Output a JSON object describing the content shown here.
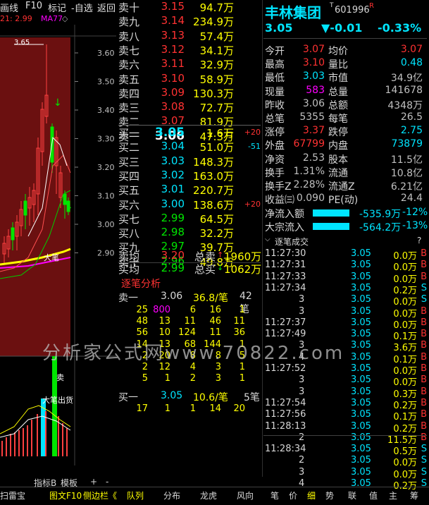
{
  "toolbar": {
    "items": [
      "画线",
      "F10",
      "标记",
      "-自选",
      "返回"
    ]
  },
  "indicator_line": {
    "prefix": "21: 2.99",
    "ma_label": "MA77"
  },
  "chart": {
    "y_ticks": [
      "3.60",
      "3.50",
      "3.40",
      "3.30",
      "3.20",
      "3.10",
      "3.00",
      "2.90"
    ],
    "high_label": "3.65",
    "big_pen_label": "大笔",
    "sub_labels": [
      "大笔出货"
    ],
    "x_ticks": [
      "2",
      "3"
    ],
    "period_label": "日线"
  },
  "stock": {
    "name": "丰林集团",
    "superscript": "T",
    "code": "601996",
    "r_mark": "R",
    "price": "3.05",
    "change": "▼-0.01",
    "change_pct": "-0.33%"
  },
  "order_book": {
    "asks": [
      {
        "label": "卖十",
        "price": "3.15",
        "vol": "94.7万"
      },
      {
        "label": "卖九",
        "price": "3.14",
        "vol": "234.9万"
      },
      {
        "label": "卖八",
        "price": "3.13",
        "vol": "57.4万"
      },
      {
        "label": "卖七",
        "price": "3.12",
        "vol": "34.1万"
      },
      {
        "label": "卖六",
        "price": "3.11",
        "vol": "32.9万"
      },
      {
        "label": "卖五",
        "price": "3.10",
        "vol": "58.9万"
      },
      {
        "label": "卖四",
        "price": "3.09",
        "vol": "130.3万"
      },
      {
        "label": "卖三",
        "price": "3.08",
        "vol": "72.7万"
      },
      {
        "label": "卖二",
        "price": "3.07",
        "vol": "81.9万"
      },
      {
        "label": "卖一",
        "price": "3.06",
        "vol": "47.3万"
      }
    ],
    "bids": [
      {
        "label": "买一",
        "price": "3.05",
        "vol": "1.6万",
        "chg": "+20"
      },
      {
        "label": "买二",
        "price": "3.04",
        "vol": "51.0万",
        "chg": "-51"
      },
      {
        "label": "买三",
        "price": "3.03",
        "vol": "148.3万",
        "chg": ""
      },
      {
        "label": "买四",
        "price": "3.02",
        "vol": "163.0万",
        "chg": ""
      },
      {
        "label": "买五",
        "price": "3.01",
        "vol": "220.7万",
        "chg": ""
      },
      {
        "label": "买六",
        "price": "3.00",
        "vol": "138.6万",
        "chg": "+20"
      },
      {
        "label": "买七",
        "price": "2.99",
        "vol": "64.5万",
        "chg": ""
      },
      {
        "label": "买八",
        "price": "2.98",
        "vol": "32.2万",
        "chg": ""
      },
      {
        "label": "买九",
        "price": "2.97",
        "vol": "39.7万",
        "chg": ""
      },
      {
        "label": "买十",
        "price": "2.96",
        "vol": "49.8万",
        "chg": ""
      }
    ],
    "ask_avg": {
      "label": "卖均",
      "price": "3.20",
      "total_label": "总卖",
      "total": "1960万"
    },
    "bid_avg": {
      "label": "买均",
      "price": "2.99",
      "total_label": "总买",
      "total": "1062万"
    }
  },
  "tick_analysis": {
    "title": "逐笔分析",
    "sell_header": {
      "label": "卖一",
      "price": "3.06",
      "vol": "36.8/笔",
      "count": "42笔"
    },
    "sell_grid": [
      [
        "25",
        "800",
        "6",
        "16",
        "1"
      ],
      [
        "48",
        "13",
        "11",
        "46",
        "11"
      ],
      [
        "56",
        "10",
        "124",
        "11",
        "36"
      ],
      [
        "14",
        "13",
        "68",
        "144",
        "1"
      ],
      [
        "2",
        "20",
        "8",
        "8",
        "5"
      ],
      [
        "2",
        "12",
        "4",
        "3",
        "1"
      ],
      [
        "5",
        "1",
        "2",
        "3",
        "1"
      ]
    ],
    "buy_header": {
      "label": "买一",
      "price": "3.05",
      "vol": "10.6/笔",
      "count": "5笔"
    },
    "buy_grid": [
      [
        "17",
        "1",
        "1",
        "14",
        "20"
      ]
    ]
  },
  "quote": {
    "rows": [
      {
        "l1": "今开",
        "v1": "3.07",
        "l2": "均价",
        "v2": "3.07"
      },
      {
        "l1": "最高",
        "v1": "3.10",
        "l2": "量比",
        "v2": "0.48"
      },
      {
        "l1": "最低",
        "v1": "3.03",
        "l2": "市值",
        "v2": "34.9亿"
      },
      {
        "l1": "现量",
        "v1": "583",
        "l2": "总量",
        "v2": "141678"
      },
      {
        "l1": "昨收",
        "v1": "3.06",
        "l2": "总额",
        "v2": "4348万"
      },
      {
        "l1": "总笔",
        "v1": "5355",
        "l2": "每笔",
        "v2": "26.5"
      },
      {
        "l1": "涨停",
        "v1": "3.37",
        "l2": "跌停",
        "v2": "2.75"
      },
      {
        "l1": "外盘",
        "v1": "67799",
        "l2": "内盘",
        "v2": "73879"
      },
      {
        "l1": "净资",
        "v1": "2.53",
        "l2": "股本",
        "v2": "11.5亿"
      },
      {
        "l1": "换手",
        "v1": "1.31%",
        "l2": "流通",
        "v2": "10.8亿"
      },
      {
        "l1": "换手Z",
        "v1": "2.28%",
        "l2": "流通Z",
        "v2": "6.21亿"
      },
      {
        "l1": "收益㈢",
        "v1": "0.090",
        "l2": "PE(动)",
        "v2": "24.4"
      }
    ],
    "net_inflow": {
      "label": "净流入额",
      "value": "-535.9万",
      "pct": "-12%"
    },
    "block_inflow": {
      "label": "大宗流入",
      "value": "-564.2万",
      "pct": "-13%"
    }
  },
  "trades": {
    "title": "逐笔成交",
    "rows": [
      {
        "time": "11:27:30",
        "price": "3.05",
        "vol": "0.0万",
        "side": "B"
      },
      {
        "time": "11:27:31",
        "price": "3.05",
        "vol": "0.0万",
        "side": "B"
      },
      {
        "time": "11:27:33",
        "price": "3.05",
        "vol": "0.0万",
        "side": "B"
      },
      {
        "time": "11:27:34",
        "price": "3.05",
        "vol": "0.2万",
        "side": "S"
      },
      {
        "time": "3",
        "price": "3.05",
        "vol": "0.0万",
        "side": "S"
      },
      {
        "time": "3",
        "price": "3.05",
        "vol": "0.0万",
        "side": "B"
      },
      {
        "time": "11:27:37",
        "price": "3.05",
        "vol": "0.0万",
        "side": "B"
      },
      {
        "time": "11:27:49",
        "price": "3.05",
        "vol": "0.1万",
        "side": "B"
      },
      {
        "time": "3",
        "price": "3.05",
        "vol": "3.6万",
        "side": "B"
      },
      {
        "time": "4",
        "price": "3.05",
        "vol": "0.1万",
        "side": "B"
      },
      {
        "time": "11:27:52",
        "price": "3.05",
        "vol": "0.0万",
        "side": "B"
      },
      {
        "time": "3",
        "price": "3.05",
        "vol": "0.0万",
        "side": "B"
      },
      {
        "time": "3",
        "price": "3.05",
        "vol": "0.3万",
        "side": "B"
      },
      {
        "time": "11:27:54",
        "price": "3.05",
        "vol": "0.2万",
        "side": "B"
      },
      {
        "time": "11:27:56",
        "price": "3.05",
        "vol": "0.1万",
        "side": "B"
      },
      {
        "time": "11:28:13",
        "price": "3.05",
        "vol": "0.2万",
        "side": "B"
      },
      {
        "time": "2",
        "price": "3.05",
        "vol": "11.5万",
        "side": "B"
      },
      {
        "time": "11:28:34",
        "price": "3.05",
        "vol": "0.5万",
        "side": "S"
      },
      {
        "time": "2",
        "price": "3.05",
        "vol": "0.0万",
        "side": "S"
      },
      {
        "time": "3",
        "price": "3.05",
        "vol": "0.0万",
        "side": "S"
      },
      {
        "time": "4",
        "price": "3.05",
        "vol": "0.2万",
        "side": "S"
      }
    ]
  },
  "bottom_tabs": {
    "left": [
      "扫雷宝",
      "指标B",
      "模板",
      "+",
      "-"
    ],
    "right": [
      "图文F10",
      "侧边栏《",
      "队列",
      "分布",
      "龙虎",
      "风向",
      "笔",
      "价",
      "细",
      "势",
      "联",
      "值",
      "主",
      "筹"
    ]
  },
  "watermark": "分析家公式网www.70822.com",
  "colors": {
    "up": "#ff3232",
    "down": "#00e600",
    "accent": "#00e5ff",
    "volume": "#ffff00",
    "chart_bg": "#6b1010"
  }
}
